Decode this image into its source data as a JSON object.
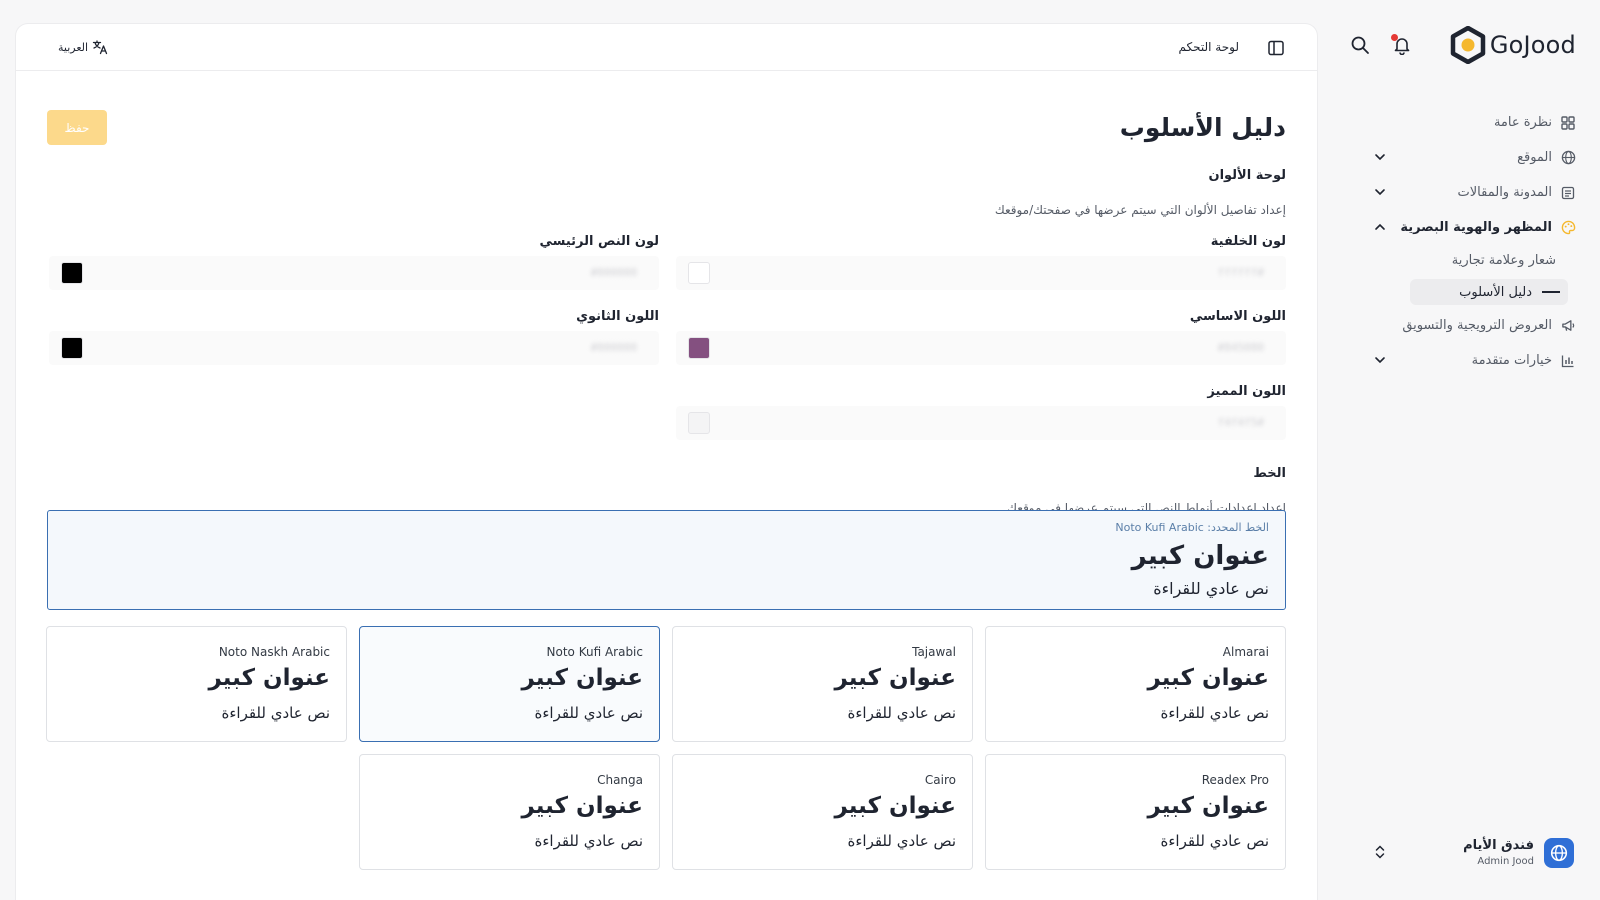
{
  "brand": {
    "name": "GoJood",
    "accent": "#f5b82e",
    "dark": "#1f2430"
  },
  "sidebar": {
    "items": [
      {
        "label": "نظرة عامة",
        "icon": "grid-icon"
      },
      {
        "label": "الموقع",
        "icon": "globe-icon"
      },
      {
        "label": "المدونة والمقالات",
        "icon": "newspaper-icon"
      },
      {
        "label": "المظهر والهوية البصرية",
        "icon": "palette-icon"
      },
      {
        "label": "العروض الترويجية والتسويق",
        "icon": "megaphone-icon"
      },
      {
        "label": "خيارات متقدمة",
        "icon": "chart-icon"
      }
    ],
    "subitems": [
      {
        "label": "شعار وعلامة تجارية"
      },
      {
        "label": "دليل الأسلوب"
      }
    ],
    "account": {
      "name": "فندق الأيام",
      "role": "Admin Jood"
    }
  },
  "topbar": {
    "title": "لوحة التحكم",
    "language": "العربية"
  },
  "page": {
    "title": "دليل الأسلوب",
    "save_label": "حفظ"
  },
  "colors": {
    "title": "لوحة الألوان",
    "description": "إعداد تفاصيل الألوان التي سيتم عرضها في صفحتك/موقعك",
    "fields": [
      {
        "label": "لون الخلفية",
        "value": "#ffffff",
        "swatch": "#ffffff"
      },
      {
        "label": "لون النص الرئيسي",
        "value": "#000000",
        "swatch": "#000000"
      },
      {
        "label": "اللون الاساسي",
        "value": "#845080",
        "swatch": "#845080"
      },
      {
        "label": "اللون الثانوي",
        "value": "#000000",
        "swatch": "#000000"
      },
      {
        "label": "اللون المميز",
        "value": "#f4f4f5",
        "swatch": "#f4f4f5"
      }
    ]
  },
  "fonts": {
    "title": "الخط",
    "description": "إعداد إعدادات أنماط النص التي سيتم عرضها في موقعك",
    "selected_label": "الخط المحدد: Noto Kufi Arabic",
    "sample_heading": "عنوان كبير",
    "sample_body": "نص عادي للقراءة",
    "options": [
      {
        "name": "Almarai"
      },
      {
        "name": "Tajawal"
      },
      {
        "name": "Noto Kufi Arabic",
        "selected": true
      },
      {
        "name": "Noto Naskh Arabic"
      },
      {
        "name": "Readex Pro"
      },
      {
        "name": "Cairo"
      },
      {
        "name": "Changa"
      }
    ]
  }
}
